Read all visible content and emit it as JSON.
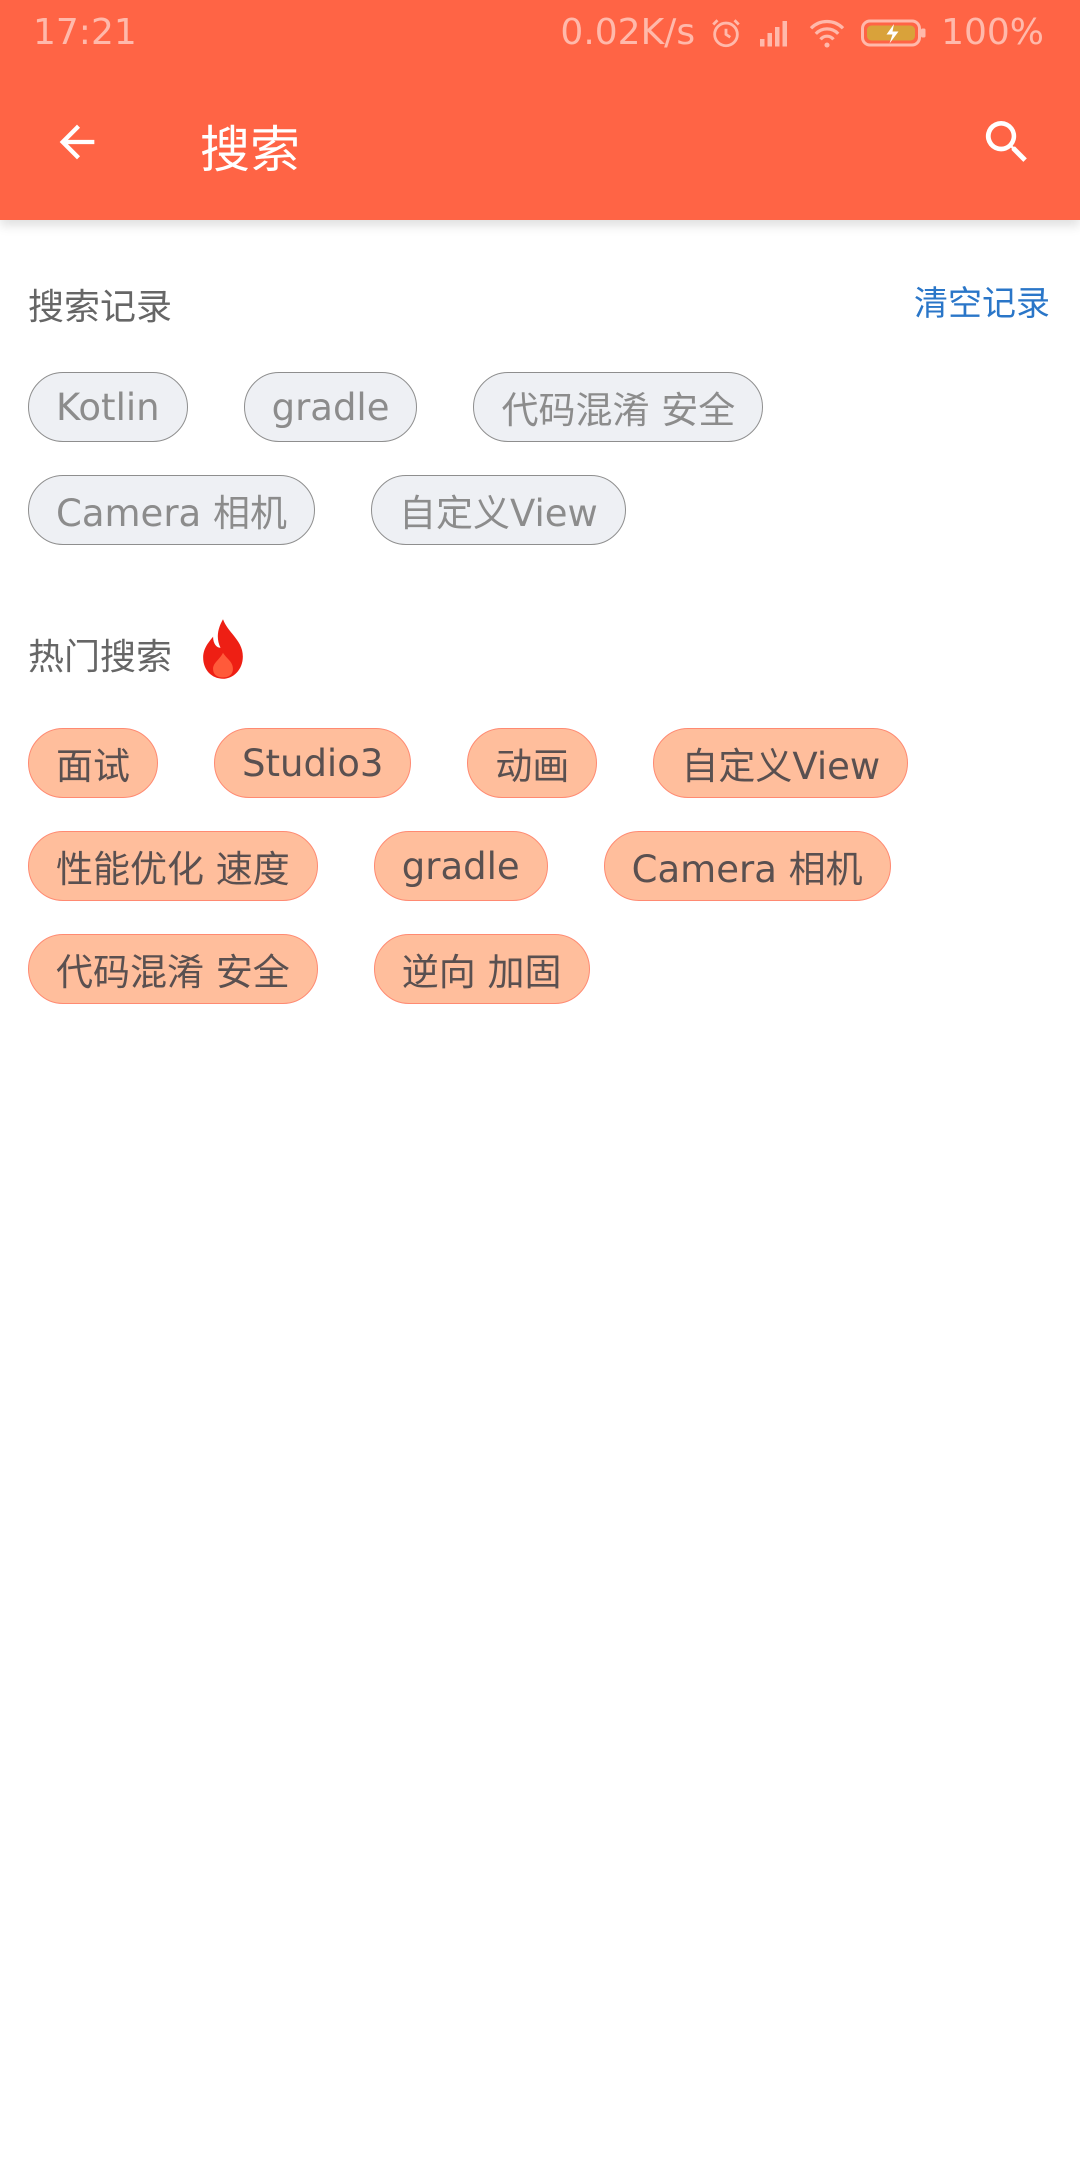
{
  "status_bar": {
    "time": "17:21",
    "net_speed": "0.02K/s",
    "battery": "100%"
  },
  "toolbar": {
    "title": "搜索",
    "back_icon": "arrow-left-icon",
    "search_icon": "search-icon"
  },
  "history": {
    "title": "搜索记录",
    "clear_label": "清空记录",
    "items": [
      "Kotlin",
      "gradle",
      "代码混淆 安全",
      "Camera 相机",
      "自定义View"
    ]
  },
  "hot": {
    "title": "热门搜索",
    "icon": "flame-icon",
    "items": [
      "面试",
      "Studio3",
      "动画",
      "自定义View",
      "性能优化 速度",
      "gradle",
      "Camera 相机",
      "代码混淆 安全",
      "逆向 加固"
    ]
  },
  "colors": {
    "toolbar": "#ff6445",
    "hot_chip_bg": "#ffbe9c",
    "history_chip_bg": "#eef0f4",
    "link": "#2a76c8"
  }
}
